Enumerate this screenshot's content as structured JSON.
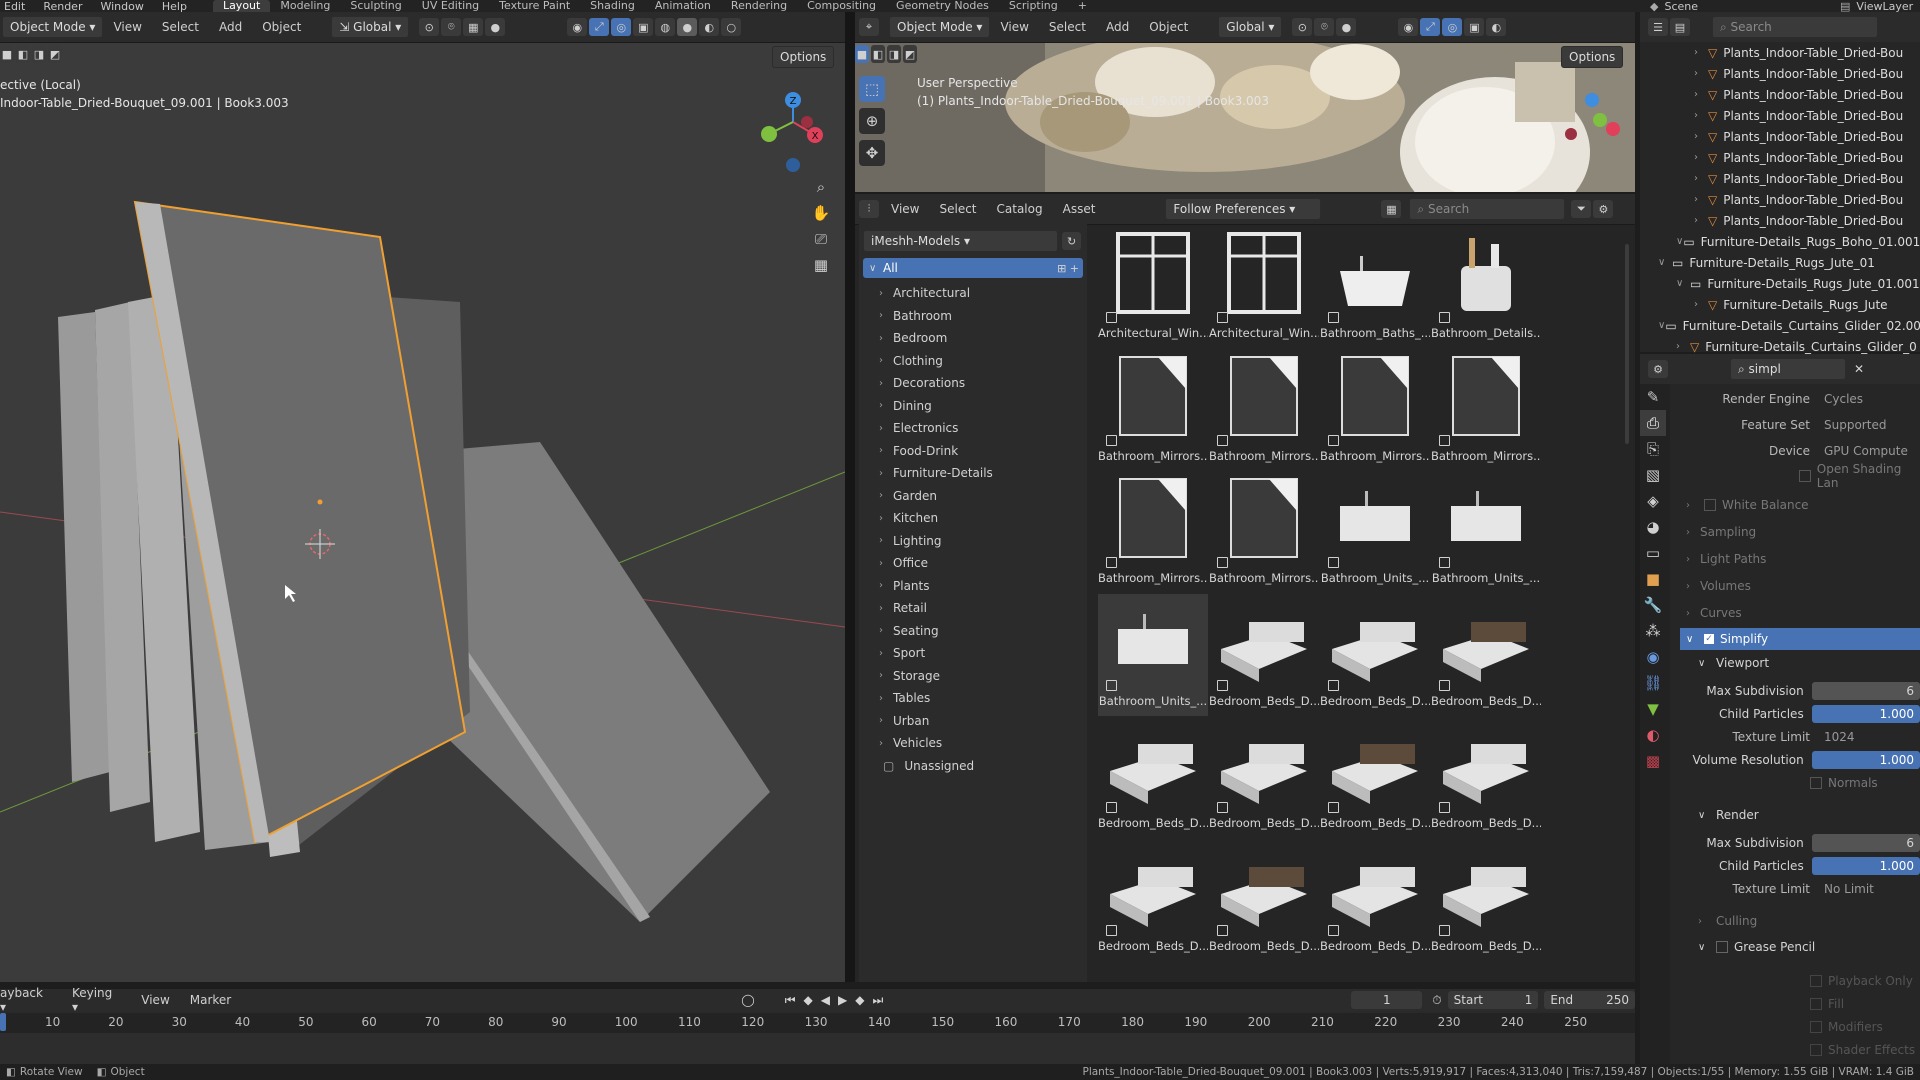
{
  "top_menu": [
    "Edit",
    "Render",
    "Window",
    "Help"
  ],
  "workspace_tabs": [
    "Layout",
    "Modeling",
    "Sculpting",
    "UV Editing",
    "Texture Paint",
    "Shading",
    "Animation",
    "Rendering",
    "Compositing",
    "Geometry Nodes",
    "Scripting"
  ],
  "active_workspace": "Layout",
  "add_workspace": "+",
  "scene_label": "Scene",
  "view_layer_label": "ViewLayer",
  "left_viewport": {
    "mode": "Object Mode",
    "menus": [
      "View",
      "Select",
      "Add",
      "Object"
    ],
    "orientation": "Global",
    "options": "Options",
    "info_line1": "ective (Local)",
    "info_line2": "Indoor-Table_Dried-Bouquet_09.001 | Book3.003"
  },
  "right_viewport": {
    "mode": "Object Mode",
    "menus": [
      "View",
      "Select",
      "Add",
      "Object"
    ],
    "orientation": "Global",
    "options": "Options",
    "info_line1": "User Perspective",
    "info_line2": "(1) Plants_Indoor-Table_Dried-Bouquet_09.001 | Book3.003"
  },
  "asset_browser": {
    "menus": [
      "View",
      "Select",
      "Catalog",
      "Asset"
    ],
    "import_method": "Follow Preferences",
    "search_placeholder": "Search",
    "library": "iMeshh-Models",
    "all_label": "All",
    "categories": [
      "Architectural",
      "Bathroom",
      "Bedroom",
      "Clothing",
      "Decorations",
      "Dining",
      "Electronics",
      "Food-Drink",
      "Furniture-Details",
      "Garden",
      "Kitchen",
      "Lighting",
      "Office",
      "Plants",
      "Retail",
      "Seating",
      "Sport",
      "Storage",
      "Tables",
      "Urban",
      "Vehicles"
    ],
    "unassigned": "Unassigned",
    "assets": [
      "Architectural_Win...",
      "Architectural_Win...",
      "Bathroom_Baths_...",
      "Bathroom_Details...",
      "Bathroom_Mirrors...",
      "Bathroom_Mirrors...",
      "Bathroom_Mirrors...",
      "Bathroom_Mirrors...",
      "Bathroom_Mirrors...",
      "Bathroom_Mirrors...",
      "Bathroom_Units_...",
      "Bathroom_Units_...",
      "Bathroom_Units_...",
      "Bedroom_Beds_D...",
      "Bedroom_Beds_D...",
      "Bedroom_Beds_D...",
      "Bedroom_Beds_D...",
      "Bedroom_Beds_D...",
      "Bedroom_Beds_D...",
      "Bedroom_Beds_D...",
      "Bedroom_Beds_D...",
      "Bedroom_Beds_D...",
      "Bedroom_Beds_D...",
      "Bedroom_Beds_D..."
    ]
  },
  "outliner": {
    "search_placeholder": "Search",
    "items": [
      {
        "label": "Plants_Indoor-Table_Dried-Bou",
        "indent": 3,
        "kind": "mesh"
      },
      {
        "label": "Plants_Indoor-Table_Dried-Bou",
        "indent": 3,
        "kind": "mesh"
      },
      {
        "label": "Plants_Indoor-Table_Dried-Bou",
        "indent": 3,
        "kind": "mesh"
      },
      {
        "label": "Plants_Indoor-Table_Dried-Bou",
        "indent": 3,
        "kind": "mesh"
      },
      {
        "label": "Plants_Indoor-Table_Dried-Bou",
        "indent": 3,
        "kind": "mesh"
      },
      {
        "label": "Plants_Indoor-Table_Dried-Bou",
        "indent": 3,
        "kind": "mesh"
      },
      {
        "label": "Plants_Indoor-Table_Dried-Bou",
        "indent": 3,
        "kind": "mesh"
      },
      {
        "label": "Plants_Indoor-Table_Dried-Bou",
        "indent": 3,
        "kind": "mesh"
      },
      {
        "label": "Plants_Indoor-Table_Dried-Bou",
        "indent": 3,
        "kind": "mesh"
      },
      {
        "label": "Furniture-Details_Rugs_Boho_01.001",
        "indent": 2,
        "kind": "collection"
      },
      {
        "label": "Furniture-Details_Rugs_Jute_01",
        "indent": 1,
        "kind": "collection"
      },
      {
        "label": "Furniture-Details_Rugs_Jute_01.001",
        "indent": 2,
        "kind": "collection"
      },
      {
        "label": "Furniture-Details_Rugs_Jute",
        "indent": 3,
        "kind": "mesh"
      },
      {
        "label": "Furniture-Details_Curtains_Glider_02.00",
        "indent": 1,
        "kind": "collection"
      },
      {
        "label": "Furniture-Details_Curtains_Glider_0",
        "indent": 2,
        "kind": "mesh"
      }
    ]
  },
  "properties": {
    "search_value": "simpl",
    "render_engine_label": "Render Engine",
    "render_engine": "Cycles",
    "feature_set_label": "Feature Set",
    "feature_set": "Supported",
    "device_label": "Device",
    "device": "GPU Compute",
    "osl_label": "Open Shading Lan",
    "collapsed_panels": [
      "White Balance",
      "Sampling",
      "Light Paths",
      "Volumes",
      "Curves"
    ],
    "simplify_label": "Simplify",
    "viewport_label": "Viewport",
    "viewport": {
      "max_subdivision_label": "Max Subdivision",
      "max_subdivision": "6",
      "child_particles_label": "Child Particles",
      "child_particles": "1.000",
      "texture_limit_label": "Texture Limit",
      "texture_limit": "1024",
      "volume_resolution_label": "Volume Resolution",
      "volume_resolution": "1.000",
      "normals_label": "Normals"
    },
    "render_label": "Render",
    "render": {
      "max_subdivision_label": "Max Subdivision",
      "max_subdivision": "6",
      "child_particles_label": "Child Particles",
      "child_particles": "1.000",
      "texture_limit_label": "Texture Limit",
      "texture_limit": "No Limit"
    },
    "culling_label": "Culling",
    "grease_pencil_label": "Grease Pencil",
    "gp_options": [
      "Playback Only",
      "Fill",
      "Modifiers",
      "Shader Effects"
    ]
  },
  "timeline": {
    "menus": [
      "ayback",
      "Keying",
      "View",
      "Marker"
    ],
    "current_frame": "1",
    "start_label": "Start",
    "start": "1",
    "end_label": "End",
    "end": "250",
    "ticks": [
      "10",
      "20",
      "30",
      "40",
      "50",
      "60",
      "70",
      "80",
      "90",
      "100",
      "110",
      "120",
      "130",
      "140",
      "150",
      "160",
      "170",
      "180",
      "190",
      "200",
      "210",
      "220",
      "230",
      "240",
      "250"
    ]
  },
  "statusbar": {
    "left1": "Rotate View",
    "left2": "Object",
    "right": "Plants_Indoor-Table_Dried-Bouquet_09.001 | Book3.003 | Verts:5,919,917 | Faces:4,313,040 | Tris:7,159,487 | Objects:1/55 | Memory: 1.55 GiB | VRAM: 1.4 GiB"
  },
  "colors": {
    "accent": "#4772b3",
    "selection": "#f0a030",
    "axis_x": "#e0405a",
    "axis_y": "#80c040",
    "axis_z": "#3d8de0"
  }
}
